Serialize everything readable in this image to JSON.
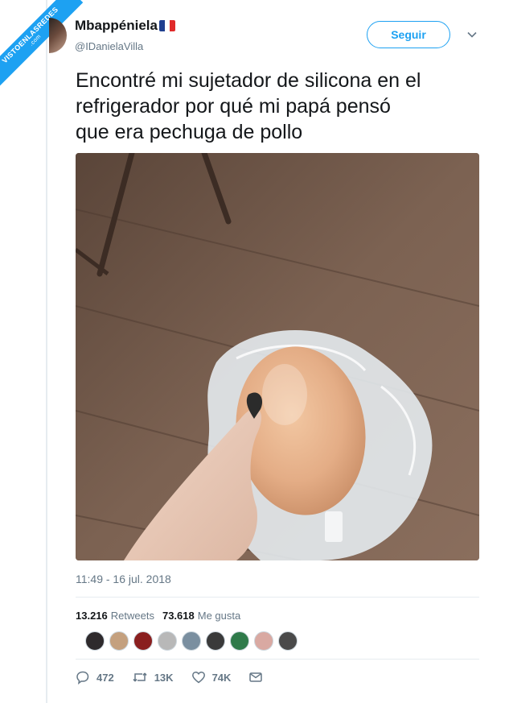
{
  "watermark": {
    "text": "VISTOENLASREDES",
    "sub": ".com"
  },
  "author": {
    "name": "Mbappéniela",
    "handle": "@IDanielaVilla"
  },
  "follow_button": {
    "label": "Seguir"
  },
  "tweet": {
    "text": "Encontré mi sujetador de silicona en el\nrefrigerador por qué  mi papá  pensó\nque era pechuga de pollo",
    "timestamp": "11:49 - 16 jul. 2018"
  },
  "stats": {
    "retweets_count": "13.216",
    "retweets_label": "Retweets",
    "likes_count": "73.618",
    "likes_label": "Me gusta"
  },
  "actions": {
    "replies": "472",
    "retweets": "13K",
    "likes": "74K"
  },
  "colors": {
    "accent": "#1da1f2",
    "muted": "#657786",
    "text": "#14171a",
    "border": "#e6ecf0"
  },
  "icons": [
    "caret-down-icon",
    "reply-icon",
    "retweet-icon",
    "heart-icon",
    "envelope-icon",
    "flag-fr-icon"
  ]
}
